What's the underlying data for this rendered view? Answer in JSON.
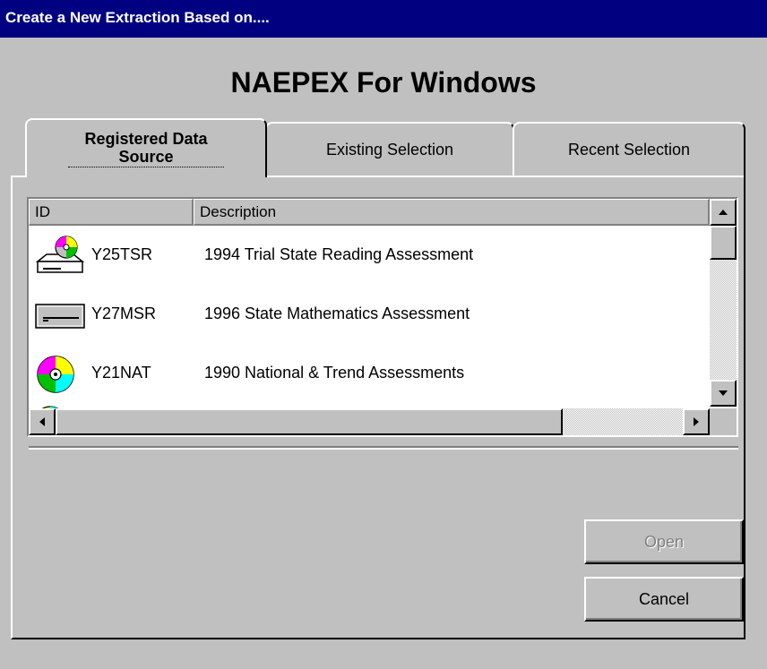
{
  "window": {
    "title": "Create a New Extraction Based on...."
  },
  "app": {
    "heading": "NAEPEX For Windows"
  },
  "tabs": [
    {
      "label": "Registered Data Source",
      "active": true
    },
    {
      "label": "Existing Selection",
      "active": false
    },
    {
      "label": "Recent Selection",
      "active": false
    }
  ],
  "list": {
    "columns": {
      "id": "ID",
      "description": "Description"
    },
    "rows": [
      {
        "icon": "drive-cd-icon",
        "id": "Y25TSR",
        "description": "1994 Trial State Reading Assessment"
      },
      {
        "icon": "hard-drive-icon",
        "id": "Y27MSR",
        "description": "1996 State Mathematics Assessment"
      },
      {
        "icon": "cd-rom-icon",
        "id": "Y21NAT",
        "description": "1990 National & Trend Assessments"
      }
    ]
  },
  "buttons": {
    "open": {
      "label": "Open",
      "enabled": false
    },
    "cancel": {
      "label": "Cancel",
      "enabled": true
    }
  },
  "colors": {
    "titlebar": "#000080",
    "face": "#c0c0c0"
  }
}
